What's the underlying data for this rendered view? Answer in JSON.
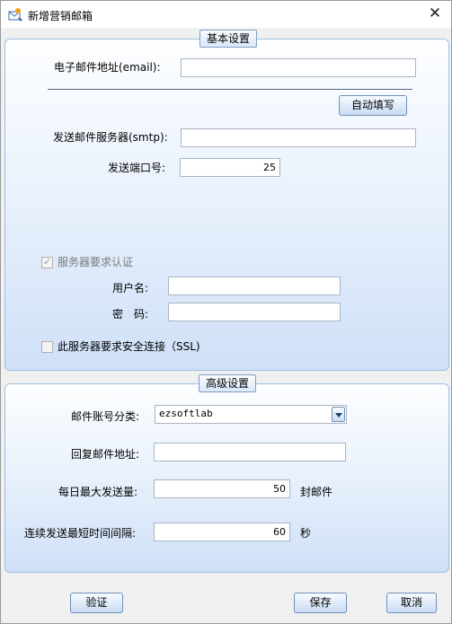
{
  "window": {
    "title": "新增营销邮箱",
    "close_glyph": "✕"
  },
  "basic": {
    "legend": "基本设置",
    "email_label": "电子邮件地址(email):",
    "email_value": "",
    "autofill_button": "自动填写",
    "smtp_label": "发送邮件服务器(smtp):",
    "smtp_value": "",
    "port_label": "发送端口号:",
    "port_value": "25",
    "auth_label": "服务器要求认证",
    "auth_checked": true,
    "username_label": "用户名:",
    "username_value": "",
    "password_label": "密　码:",
    "password_value": "",
    "ssl_label": "此服务器要求安全连接（SSL)",
    "ssl_checked": false
  },
  "advanced": {
    "legend": "高级设置",
    "category_label": "邮件账号分类:",
    "category_value": "ezsoftlab",
    "reply_label": "回复邮件地址:",
    "reply_value": "",
    "daily_max_label": "每日最大发送量:",
    "daily_max_value": "50",
    "daily_max_unit": "封邮件",
    "interval_label": "连续发送最短时间间隔:",
    "interval_value": "60",
    "interval_unit": "秒"
  },
  "footer": {
    "verify_button": "验证",
    "save_button": "保存",
    "cancel_button": "取消"
  },
  "icons": {
    "app": "mail-app-icon",
    "checkmark": "check-icon",
    "dropdown": "chevron-down-icon"
  },
  "colors": {
    "panel_border": "#9fbfe3",
    "panel_gradient_bottom": "#cfe0f7",
    "button_border": "#6f8fb8"
  }
}
